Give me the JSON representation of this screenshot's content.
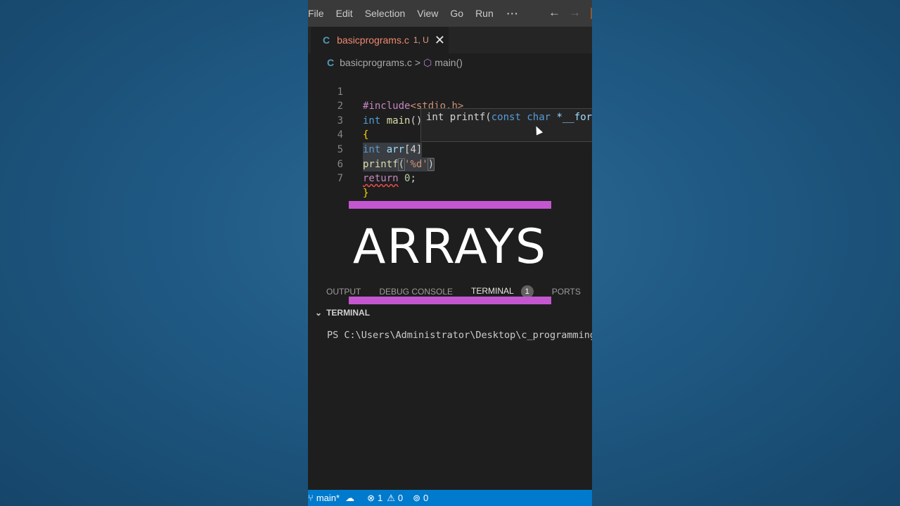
{
  "menubar": {
    "items": [
      "File",
      "Edit",
      "Selection",
      "View",
      "Go",
      "Run"
    ],
    "more": "···",
    "back_icon": "←",
    "forward_icon": "→"
  },
  "tab": {
    "lang_icon": "C",
    "filename": "basicprograms.c",
    "status": "1, U",
    "close": "✕"
  },
  "breadcrumb": {
    "lang_icon": "C",
    "file": "basicprograms.c",
    "separator": ">",
    "symbol_icon": "⬡",
    "symbol": "main()"
  },
  "code": {
    "line_numbers": [
      "1",
      "2",
      "3",
      "4",
      "5",
      "6",
      "7"
    ],
    "l1_directive": "#include",
    "l1_path": "<stdio.h>",
    "l2_type": "int",
    "l2_name": "main",
    "l2_parens": "()",
    "l3_brace": "{",
    "l4_type": "int",
    "l4_var": "arr",
    "l4_index": "[4]",
    "l5_fn": "printf",
    "l5_open": "(",
    "l5_str": "'%d'",
    "l5_close": ")",
    "l6_return": "return",
    "l6_value": "0",
    "l6_semi": ";",
    "l7_brace": "}"
  },
  "hover": {
    "ret_type": "int",
    "name": "printf(",
    "param_const": "const",
    "param_type": "char",
    "param_name": "*__form"
  },
  "overlay": {
    "headline": "ARRAYS",
    "accent_color": "#c457d0"
  },
  "panel_tabs": {
    "output": "OUTPUT",
    "debug_console": "DEBUG CONSOLE",
    "terminal": "TERMINAL",
    "terminal_badge": "1",
    "ports": "PORTS"
  },
  "terminal": {
    "header": "TERMINAL",
    "prompt": "PS C:\\Users\\Administrator\\Desktop\\c_programming\\p"
  },
  "statusbar": {
    "branch": "main*",
    "errors": "1",
    "warnings": "0",
    "ports": "0",
    "color": "#007acc"
  }
}
